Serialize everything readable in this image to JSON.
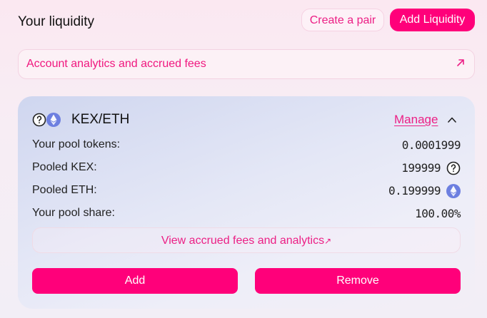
{
  "header": {
    "title": "Your liquidity",
    "create_pair_label": "Create a pair",
    "add_liquidity_label": "Add Liquidity"
  },
  "analytics_bar": {
    "label": "Account analytics and accrued fees",
    "icon": "arrow-up-right-icon"
  },
  "pool": {
    "pair_name": "KEX/ETH",
    "token_icons": [
      "question-circle-icon",
      "ethereum-icon"
    ],
    "manage_label": "Manage",
    "rows": [
      {
        "label": "Your pool tokens:",
        "value": "0.0001999"
      },
      {
        "label": "Pooled KEX:",
        "value": "199999",
        "icon": "question-circle-icon"
      },
      {
        "label": "Pooled ETH:",
        "value": "0.199999",
        "icon": "ethereum-icon"
      },
      {
        "label": "Your pool share:",
        "value": "100.00%"
      }
    ],
    "view_fees_label": "View accrued fees and analytics",
    "view_fees_arrow": "↗",
    "add_label": "Add",
    "remove_label": "Remove"
  },
  "colors": {
    "accent": "#ff007a",
    "accent_text": "#ec1f85",
    "eth_icon": "#6d7fe0"
  }
}
